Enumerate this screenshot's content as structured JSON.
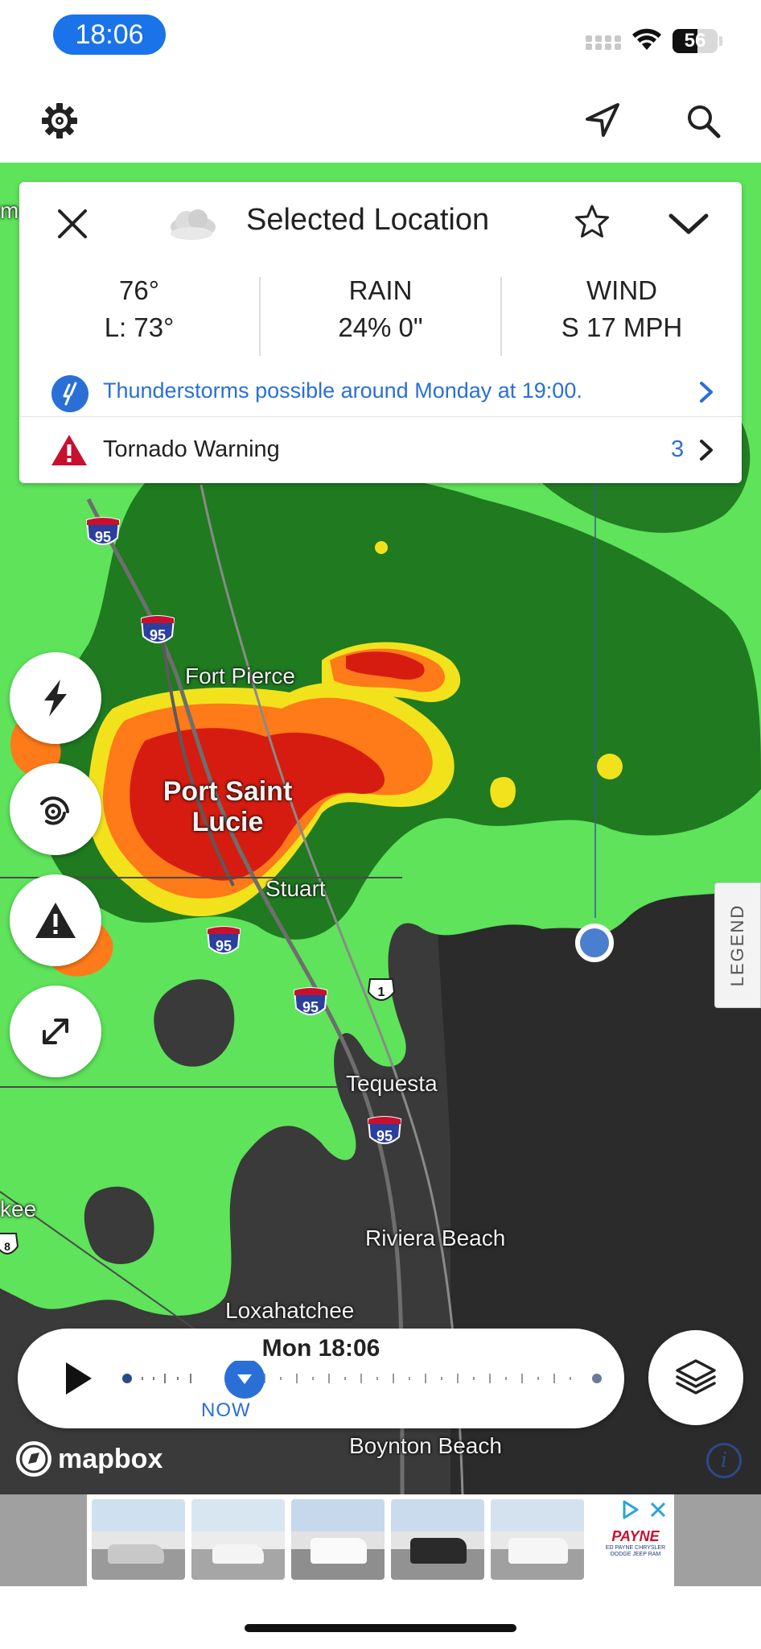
{
  "status_bar": {
    "time": "18:06",
    "battery": "56",
    "battery_level": 0.56
  },
  "toolbar": {
    "settings_icon": "gear-icon",
    "location_icon": "navigation-arrow-icon",
    "search_icon": "search-icon"
  },
  "card": {
    "title": "Selected Location",
    "weather_icon": "cloud-icon",
    "temp_high": "76°",
    "temp_low": "L: 73°",
    "rain_label": "RAIN",
    "rain_value": "24% 0\"",
    "wind_label": "WIND",
    "wind_value": "S 17 MPH",
    "forecast_text": "Thunderstorms possible around Monday at 19:00.",
    "warning_text": "Tornado Warning",
    "warning_count": "3"
  },
  "map": {
    "labels": {
      "fort_pierce": "Fort Pierce",
      "psl_line1": "Port Saint",
      "psl_line2": "Lucie",
      "stuart": "Stuart",
      "tequesta": "Tequesta",
      "riviera_beach": "Riviera Beach",
      "loxahatchee": "Loxahatchee",
      "boynton_beach": "Boynton Beach",
      "kee": "kee",
      "m_edge": "m"
    },
    "highway_95": "95",
    "highway_1": "1",
    "highway_8": "8",
    "legend_label": "LEGEND"
  },
  "side_buttons": {
    "lightning_icon": "lightning-icon",
    "tropical_icon": "hurricane-icon",
    "alert_icon": "warning-icon",
    "expand_icon": "expand-icon"
  },
  "timeline": {
    "timestamp": "Mon 18:06",
    "now_label": "NOW"
  },
  "attribution": {
    "mapbox": "mapbox",
    "info": "i"
  },
  "ad": {
    "brand": "PAYNE",
    "brand_sub": "ED PAYNE CHRYSLER DODGE JEEP RAM"
  },
  "colors": {
    "accent": "#2a6fd6",
    "time_pill": "#1a73e8",
    "warning_red": "#c8102e",
    "radar_light_green": "#5ee35a",
    "radar_dark_green": "#1f7a20",
    "radar_yellow": "#f2e21c",
    "radar_orange": "#ff7a18",
    "radar_red": "#d61c10"
  }
}
